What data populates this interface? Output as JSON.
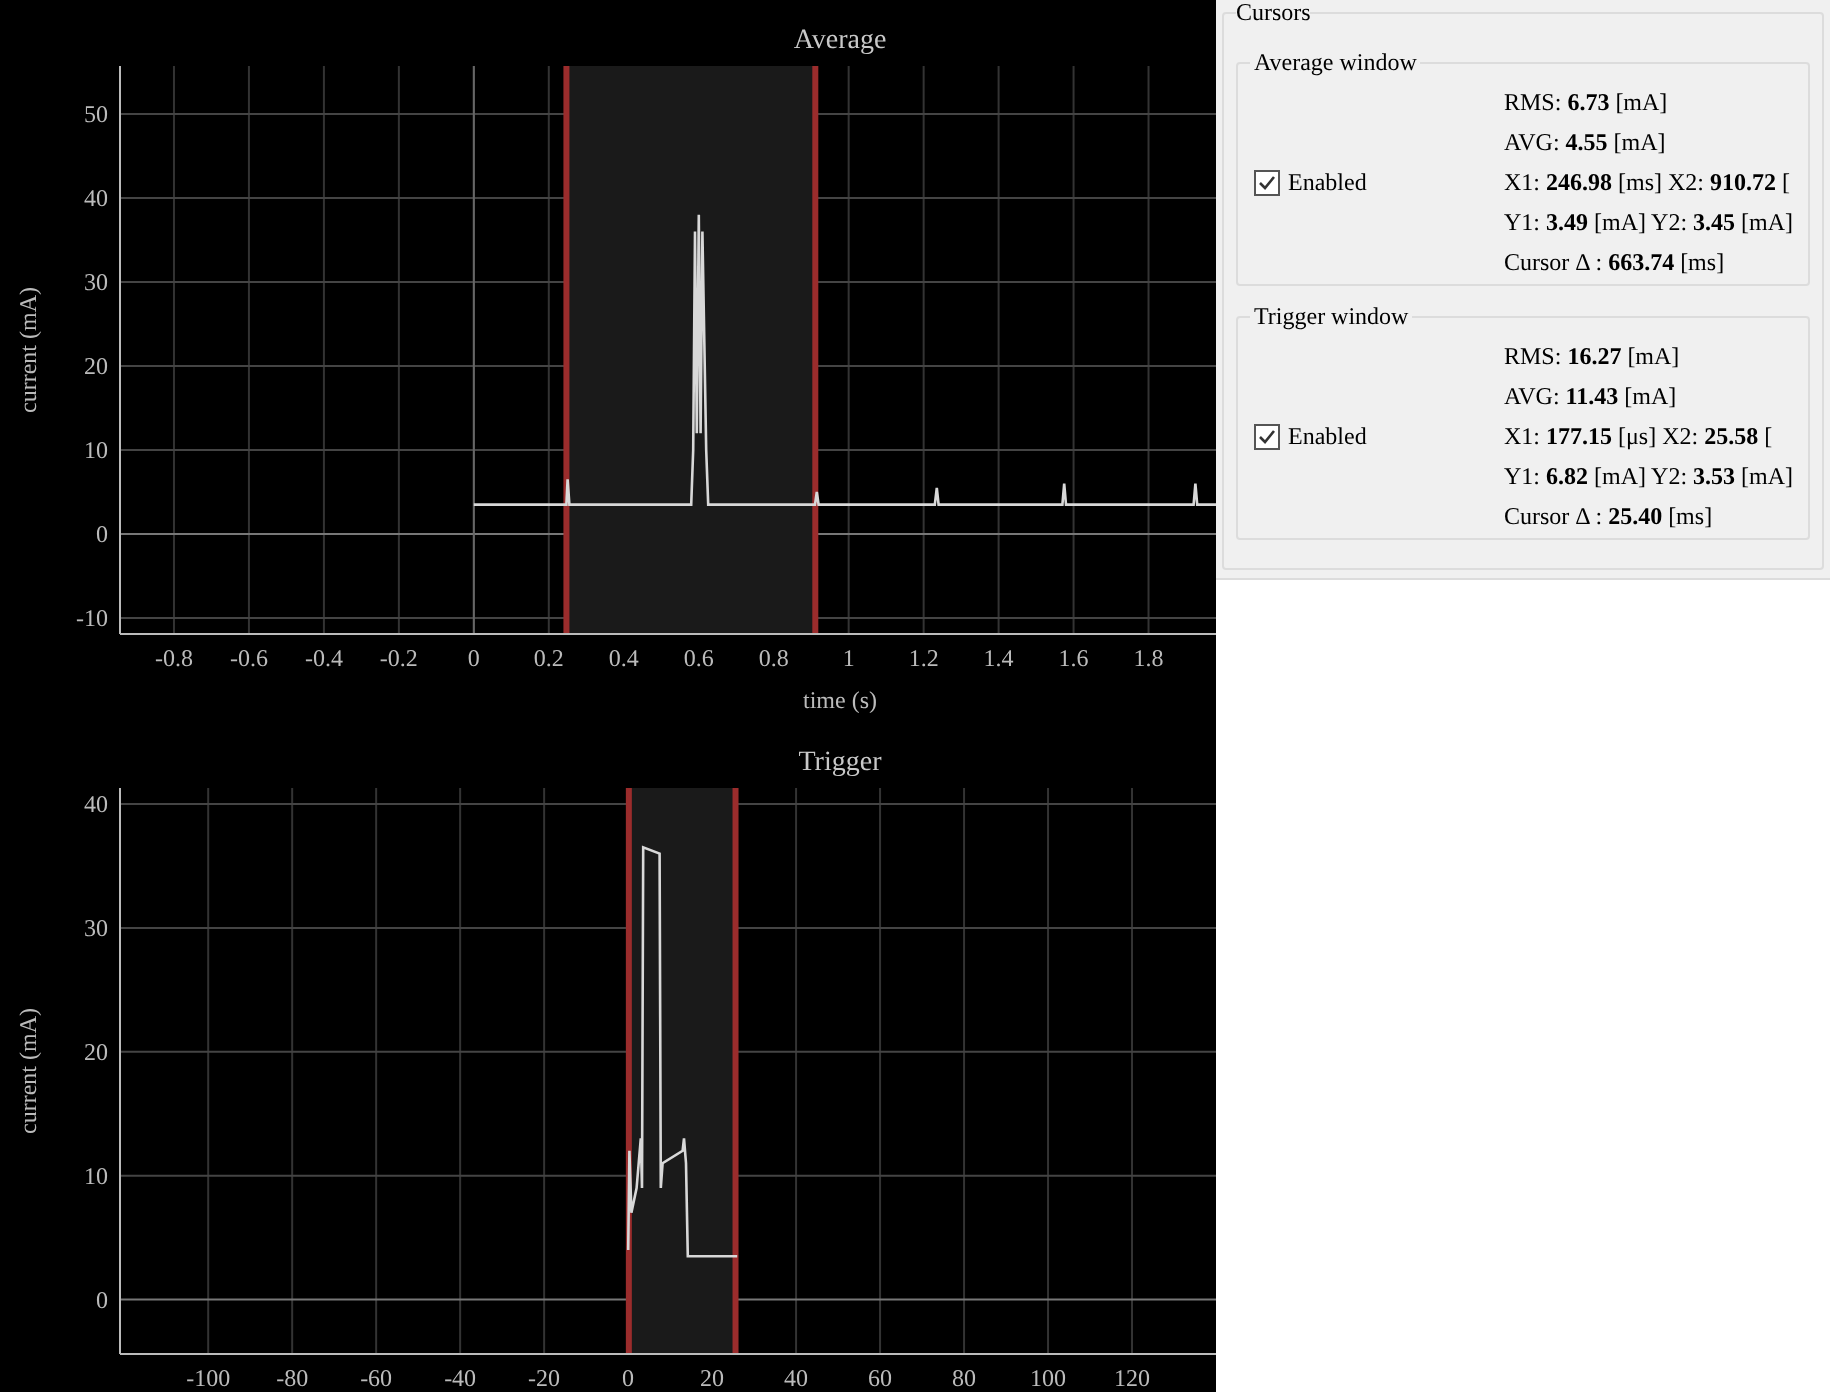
{
  "charts": [
    {
      "chart_data": {
        "type": "line",
        "title": "Average",
        "grid": true,
        "xlabel": "time (s)",
        "ylabel": "current (mA)",
        "xlim": [
          -0.944,
          1.98
        ],
        "ylim": [
          -11.9,
          55.7
        ],
        "xticks": [
          -0.8,
          -0.6,
          -0.4,
          -0.2,
          0,
          0.2,
          0.4,
          0.6,
          0.8,
          1,
          1.2,
          1.4,
          1.6,
          1.8
        ],
        "yticks": [
          -10,
          0,
          10,
          20,
          30,
          40,
          50
        ],
        "x": [
          0,
          0.247,
          0.25,
          0.255,
          0.58,
          0.585,
          0.59,
          0.595,
          0.6,
          0.605,
          0.61,
          0.62,
          0.625,
          0.91,
          0.915,
          0.92,
          1.23,
          1.235,
          1.24,
          1.57,
          1.575,
          1.58,
          1.92,
          1.925,
          1.93,
          1.98
        ],
        "series": [
          {
            "color": "#d8d8d8",
            "values": [
              3.5,
              3.5,
              6.5,
              3.5,
              3.5,
              10,
              36,
              12,
              38,
              12,
              36,
              10,
              3.5,
              3.5,
              5,
              3.5,
              3.5,
              5.5,
              3.5,
              3.5,
              6,
              3.5,
              3.5,
              6,
              3.5,
              3.5
            ]
          }
        ],
        "bands": [
          {
            "axis": "x",
            "from": 0.247,
            "to": 0.911
          }
        ]
      }
    },
    {
      "chart_data": {
        "type": "line",
        "title": "Trigger",
        "grid": true,
        "ylabel": "current (mA)",
        "xlim": [
          -121,
          140
        ],
        "ylim": [
          -4.4,
          41.3
        ],
        "xticks": [
          -100,
          -80,
          -60,
          -40,
          -20,
          0,
          20,
          40,
          60,
          80,
          100,
          120
        ],
        "yticks": [
          0,
          10,
          20,
          30,
          40
        ],
        "x": [
          0,
          0.3,
          0.8,
          2,
          3,
          3.3,
          3.6,
          7.5,
          7.8,
          8.2,
          13,
          13.3,
          13.8,
          14.2,
          26
        ],
        "series": [
          {
            "color": "#d8d8d8",
            "values": [
              4,
              12,
              7,
              9,
              13,
              9,
              36.5,
              36,
              9,
              11,
              12,
              13,
              11,
              3.5,
              3.5
            ]
          }
        ],
        "bands": [
          {
            "axis": "x",
            "from": 0.177,
            "to": 25.58
          }
        ]
      }
    }
  ],
  "cursors": {
    "title": "Cursors",
    "groups": [
      {
        "title": "Average window",
        "enabled": {
          "label": "Enabled",
          "checked": true
        },
        "lines": [
          "RMS: **6.73** [mA]",
          "AVG: **4.55** [mA]",
          "X1: **246.98** [ms] X2: **910.72** [",
          "Y1: **3.49** [mA] Y2: **3.45** [mA]",
          "Cursor Δ : **663.74** [ms]"
        ]
      },
      {
        "title": "Trigger window",
        "enabled": {
          "label": "Enabled",
          "checked": true
        },
        "lines": [
          "RMS: **16.27** [mA]",
          "AVG: **11.43** [mA]",
          "X1: **177.15** [μs] X2: **25.58** [",
          "Y1: **6.82** [mA] Y2: **3.53** [mA]",
          "Cursor Δ : **25.40** [ms]"
        ]
      }
    ]
  }
}
